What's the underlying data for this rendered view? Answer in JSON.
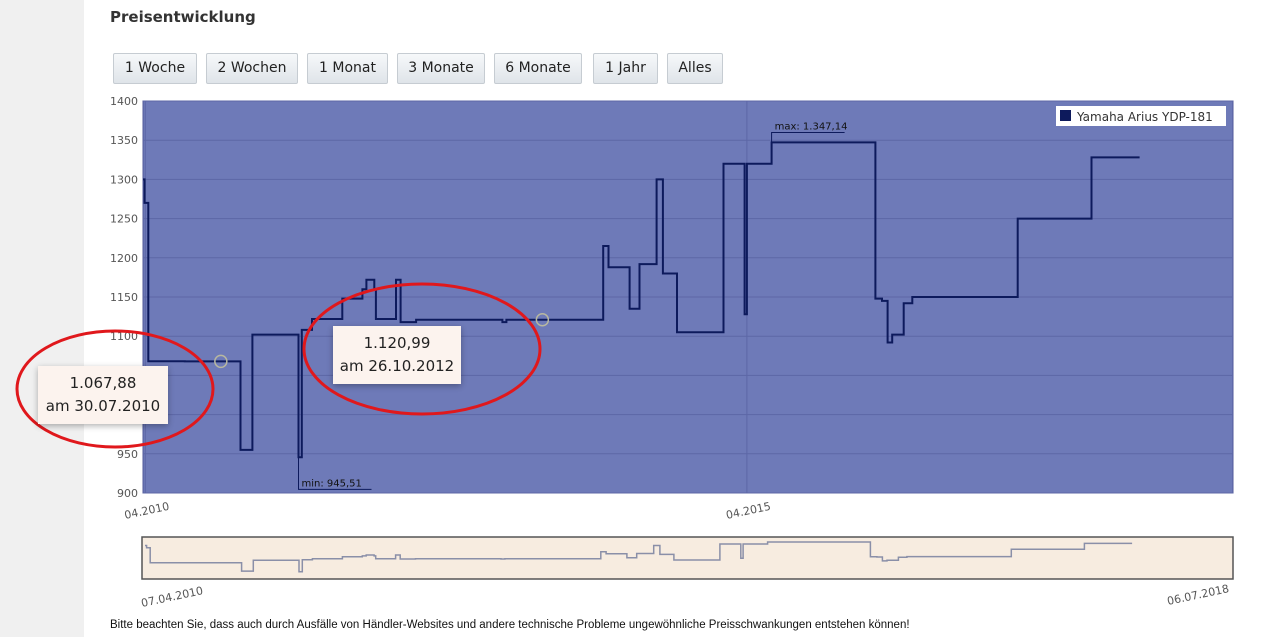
{
  "section_title": "Preisentwicklung",
  "range_buttons": [
    {
      "label": "1 Woche"
    },
    {
      "label": "2 Wochen"
    },
    {
      "label": "1 Monat"
    },
    {
      "label": "3 Monate"
    },
    {
      "label": "6 Monate"
    },
    {
      "label": "1 Jahr"
    },
    {
      "label": "Alles"
    }
  ],
  "chart_data": {
    "type": "line",
    "title": "",
    "xlabel": "",
    "ylabel": "",
    "x_start": "2010-03-25",
    "ylim": [
      900,
      1400
    ],
    "yticks": [
      900,
      950,
      1000,
      1050,
      1100,
      1150,
      1200,
      1250,
      1300,
      1350,
      1400
    ],
    "xticks": [
      {
        "label": "04.2010",
        "date": "2010-04-01"
      },
      {
        "label": "04.2015",
        "date": "2015-04-01"
      }
    ],
    "grid": true,
    "legend_position": "top-right",
    "series": [
      {
        "name": "Yamaha Arius YDP-181",
        "color": "#0d1a5c",
        "points": [
          [
            "2010-03-25",
            1300
          ],
          [
            "2010-03-30",
            1270
          ],
          [
            "2010-04-10",
            1068
          ],
          [
            "2010-07-30",
            1067.88
          ],
          [
            "2011-01-15",
            955
          ],
          [
            "2011-02-20",
            1102
          ],
          [
            "2011-07-01",
            1102
          ],
          [
            "2011-07-10",
            945.51
          ],
          [
            "2011-07-20",
            1108
          ],
          [
            "2011-08-20",
            1122
          ],
          [
            "2011-11-20",
            1148
          ],
          [
            "2012-01-20",
            1160
          ],
          [
            "2012-02-01",
            1172
          ],
          [
            "2012-02-25",
            1160
          ],
          [
            "2012-03-01",
            1122
          ],
          [
            "2012-05-01",
            1172
          ],
          [
            "2012-05-15",
            1118
          ],
          [
            "2012-07-01",
            1120.99
          ],
          [
            "2013-03-20",
            1118
          ],
          [
            "2013-04-01",
            1120.99
          ],
          [
            "2014-01-01",
            1120.99
          ],
          [
            "2014-01-20",
            1215
          ],
          [
            "2014-02-05",
            1188
          ],
          [
            "2014-04-10",
            1135
          ],
          [
            "2014-05-10",
            1192
          ],
          [
            "2014-07-01",
            1300
          ],
          [
            "2014-07-20",
            1180
          ],
          [
            "2014-09-01",
            1105
          ],
          [
            "2015-01-01",
            1105
          ],
          [
            "2015-01-20",
            1320
          ],
          [
            "2015-03-01",
            1320
          ],
          [
            "2015-03-25",
            1128
          ],
          [
            "2015-04-01",
            1320
          ],
          [
            "2015-05-01",
            1320
          ],
          [
            "2015-06-15",
            1347.14
          ],
          [
            "2016-04-01",
            1347.14
          ],
          [
            "2016-04-25",
            1148
          ],
          [
            "2016-05-15",
            1145
          ],
          [
            "2016-06-01",
            1092
          ],
          [
            "2016-06-15",
            1102
          ],
          [
            "2016-07-20",
            1142
          ],
          [
            "2016-08-15",
            1150
          ],
          [
            "2017-06-20",
            1150
          ],
          [
            "2017-07-01",
            1250
          ],
          [
            "2018-02-01",
            1250
          ],
          [
            "2018-02-10",
            1328
          ],
          [
            "2018-07-06",
            1328
          ]
        ]
      }
    ],
    "annotations": [
      {
        "label": "max: 1.347,14",
        "date": "2015-06-15",
        "value": 1347.14
      },
      {
        "label": "min: 945,51",
        "date": "2011-07-10",
        "value": 945.51
      }
    ],
    "tooltips": [
      {
        "value": "1.067,88",
        "date": "am 30.07.2010",
        "x_date": "2010-07-30",
        "y": 1067.88
      },
      {
        "value": "1.120,99",
        "date": "am 26.10.2012",
        "x_date": "2013-04-01",
        "y": 1120.99
      }
    ],
    "navigator": {
      "start_label": "07.04.2010",
      "end_label": "06.07.2018",
      "start_date": "2010-04-07",
      "end_date": "2018-07-06"
    },
    "colors": {
      "plot_background": "#6e7ab8",
      "line": "#0d1a5c",
      "navigator_background": "#f7ece0",
      "navigator_line": "#8a8fa8",
      "highlight_ellipse": "#e0181c"
    }
  },
  "notice": "Bitte beachten Sie, dass auch durch Ausfälle von Händler-Websites und andere technische Probleme ungewöhnliche Preisschwankungen entstehen können!"
}
